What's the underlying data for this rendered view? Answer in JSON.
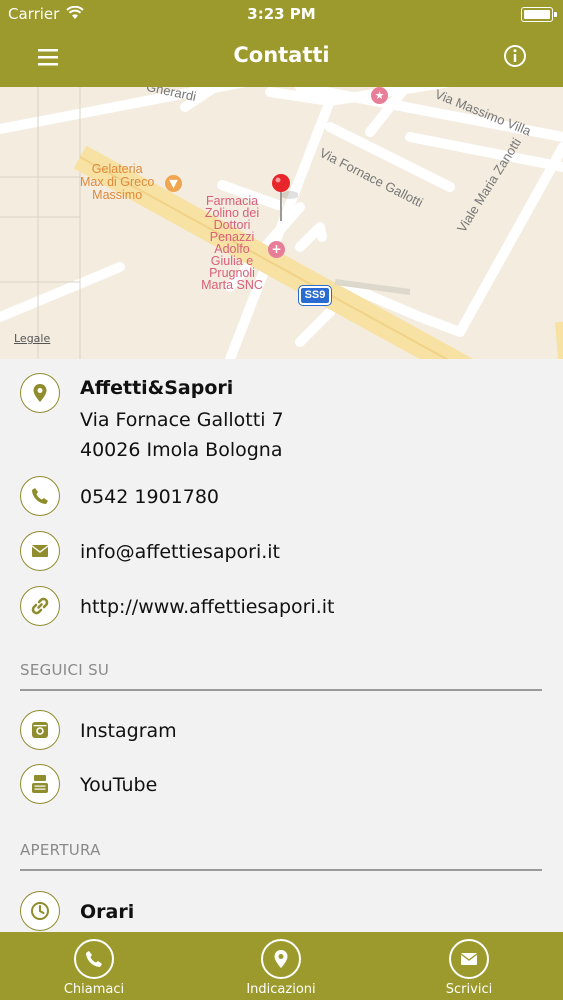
{
  "status_bar": {
    "carrier": "Carrier",
    "time": "3:23 PM"
  },
  "nav": {
    "title": "Contatti"
  },
  "map": {
    "legal": "Legale",
    "streets": [
      "Gherardi",
      "Via Massimo Villa",
      "Via Fornace Gallotti",
      "Viale Maria Zanotti"
    ],
    "pois": [
      {
        "lines": [
          "Gelateria",
          "Max di Greco",
          "Massimo"
        ]
      },
      {
        "lines": [
          "Farmacia",
          "Zolino dei",
          "Dottori",
          "Penazzi",
          "Adolfo",
          "Giulia e",
          "Prugnoli",
          "Marta SNC"
        ]
      }
    ],
    "road_badge": "SS9"
  },
  "contact": {
    "name": "Affetti&Sapori",
    "address_line1": "Via Fornace Gallotti 7",
    "address_line2": "40026 Imola Bologna",
    "phone": "0542 1901780",
    "email": "info@affettiesapori.it",
    "website": "http://www.affettiesapori.it"
  },
  "social": {
    "title": "SEGUICI SU",
    "instagram": "Instagram",
    "youtube": "YouTube"
  },
  "opening": {
    "title": "APERTURA",
    "hours_label": "Orari"
  },
  "tabs": [
    {
      "label": "Chiamaci"
    },
    {
      "label": "Indicazioni"
    },
    {
      "label": "Scrivici"
    }
  ],
  "colors": {
    "accent": "#9c9a2c",
    "icon_border": "#8f8d2e",
    "map_bg": "#f3ecdf",
    "poi": "#d9607a"
  }
}
